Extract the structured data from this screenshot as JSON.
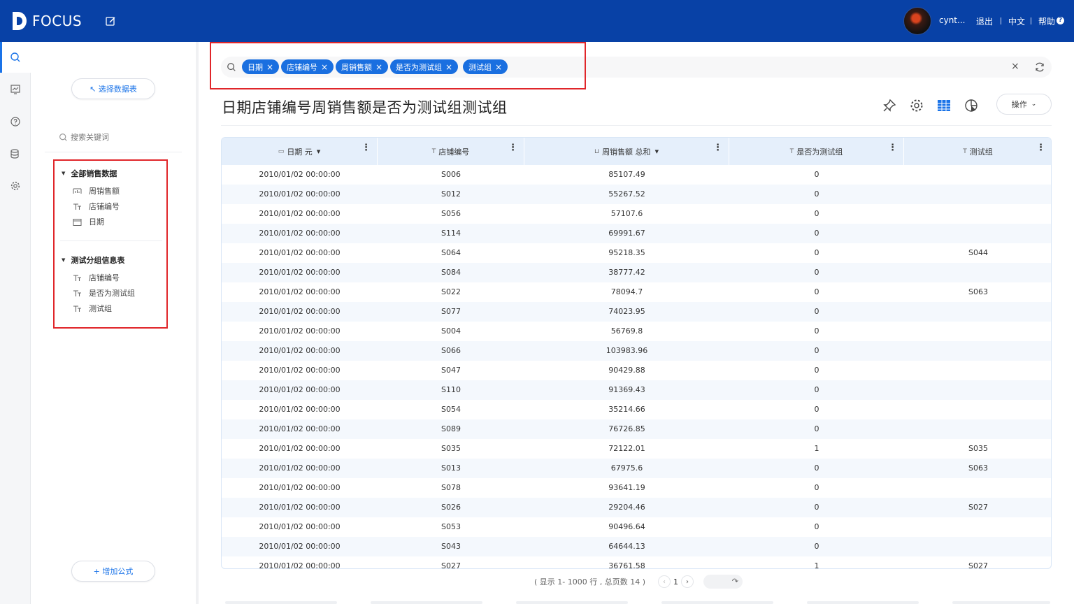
{
  "header": {
    "logo_text": "FOCUS",
    "username": "cynt...",
    "logout": "退出",
    "language": "中文",
    "help": "帮助"
  },
  "panel": {
    "select_table": "↖ 选择数据表",
    "search_placeholder": "搜索关键词",
    "groups": [
      {
        "title": "全部销售数据",
        "items": [
          "周销售额",
          "店铺编号",
          "日期"
        ]
      },
      {
        "title": "测试分组信息表",
        "items": [
          "店铺编号",
          "是否为测试组",
          "测试组"
        ]
      }
    ],
    "add_formula": "+ 增加公式"
  },
  "search": {
    "tokens": [
      "日期",
      "店铺编号",
      "周销售额",
      "是否为测试组",
      "测试组"
    ]
  },
  "title": "日期店铺编号周销售额是否为测试组测试组",
  "operate": "操作",
  "table": {
    "columns": [
      {
        "label": "日期 元",
        "icon": "calendar-icon"
      },
      {
        "label": "店铺编号",
        "icon": "text-type-icon"
      },
      {
        "label": "周销售额 总和",
        "icon": "measure-icon"
      },
      {
        "label": "是否为测试组",
        "icon": "text-type-icon"
      },
      {
        "label": "测试组",
        "icon": "text-type-icon"
      }
    ],
    "rows": [
      [
        "2010/01/02 00:00:00",
        "S006",
        "85107.49",
        "0",
        ""
      ],
      [
        "2010/01/02 00:00:00",
        "S012",
        "55267.52",
        "0",
        ""
      ],
      [
        "2010/01/02 00:00:00",
        "S056",
        "57107.6",
        "0",
        ""
      ],
      [
        "2010/01/02 00:00:00",
        "S114",
        "69991.67",
        "0",
        ""
      ],
      [
        "2010/01/02 00:00:00",
        "S064",
        "95218.35",
        "0",
        "S044"
      ],
      [
        "2010/01/02 00:00:00",
        "S084",
        "38777.42",
        "0",
        ""
      ],
      [
        "2010/01/02 00:00:00",
        "S022",
        "78094.7",
        "0",
        "S063"
      ],
      [
        "2010/01/02 00:00:00",
        "S077",
        "74023.95",
        "0",
        ""
      ],
      [
        "2010/01/02 00:00:00",
        "S004",
        "56769.8",
        "0",
        ""
      ],
      [
        "2010/01/02 00:00:00",
        "S066",
        "103983.96",
        "0",
        ""
      ],
      [
        "2010/01/02 00:00:00",
        "S047",
        "90429.88",
        "0",
        ""
      ],
      [
        "2010/01/02 00:00:00",
        "S110",
        "91369.43",
        "0",
        ""
      ],
      [
        "2010/01/02 00:00:00",
        "S054",
        "35214.66",
        "0",
        ""
      ],
      [
        "2010/01/02 00:00:00",
        "S089",
        "76726.85",
        "0",
        ""
      ],
      [
        "2010/01/02 00:00:00",
        "S035",
        "72122.01",
        "1",
        "S035"
      ],
      [
        "2010/01/02 00:00:00",
        "S013",
        "67975.6",
        "0",
        "S063"
      ],
      [
        "2010/01/02 00:00:00",
        "S078",
        "93641.19",
        "0",
        ""
      ],
      [
        "2010/01/02 00:00:00",
        "S026",
        "29204.46",
        "0",
        "S027"
      ],
      [
        "2010/01/02 00:00:00",
        "S053",
        "90496.64",
        "0",
        ""
      ],
      [
        "2010/01/02 00:00:00",
        "S043",
        "64644.13",
        "0",
        ""
      ],
      [
        "2010/01/02 00:00:00",
        "S027",
        "36761.58",
        "1",
        "S027"
      ]
    ]
  },
  "pager": {
    "summary": "( 显示 1- 1000 行 , 总页数 14 )",
    "current_page": "1"
  }
}
